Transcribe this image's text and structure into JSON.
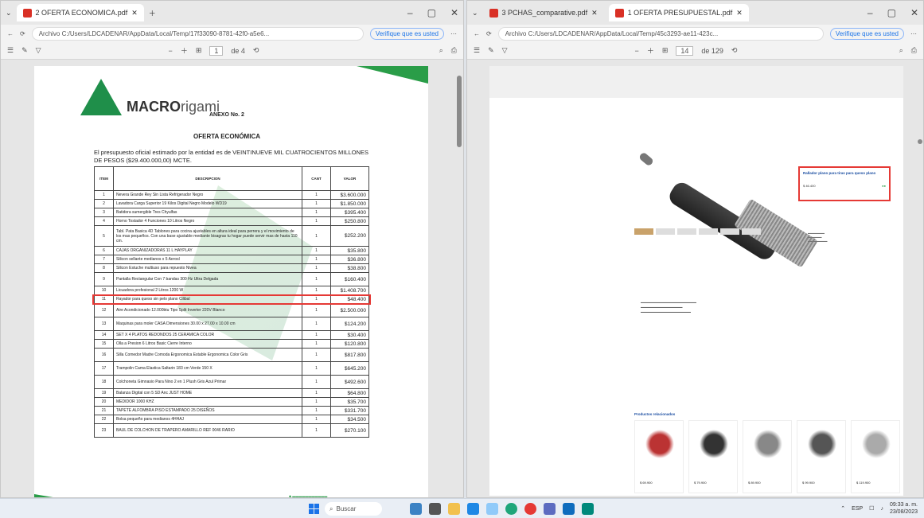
{
  "left": {
    "tab_title": "2 OFERTA ECONOMICA.pdf",
    "url": "Archivo C:/Users/LDCADENAR/AppData/Local/Temp/17f33090-8781-42f0-a5e6...",
    "verify_pill": "Verifique que es usted",
    "page_num": "1",
    "page_total": "de 4",
    "doc": {
      "brand_bold": "MACRO",
      "brand_light": "rigami",
      "anexo": "ANEXO No. 2",
      "oferta": "OFERTA ECONÓMICA",
      "intro": "El presupuesto oficial estimado por la entidad es de VEINTINUEVE MIL CUATROCIENTOS MILLONES DE PESOS ($29.400.000,00) MCTE.",
      "col_item": "ITEM",
      "col_desc": "DESCRIPCION",
      "col_qty": "CANT",
      "col_val": "VALOR",
      "rows": [
        {
          "item": "1",
          "desc": "Nevera Grande Rey Sin Lista Refrigerador Negro",
          "qty": "1",
          "val": "$3.600.000"
        },
        {
          "item": "2",
          "desc": "Lavadora Carga Superior 19 Kilos Digital Negro Modelo WD19",
          "qty": "1",
          "val": "$1.850.000"
        },
        {
          "item": "3",
          "desc": "Batidora sumergible Tres Chyulfas",
          "qty": "1",
          "val": "$395.400"
        },
        {
          "item": "4",
          "desc": "Horno Tostador 4 Funciones 10 Litros Negro",
          "qty": "1",
          "val": "$250.800"
        },
        {
          "item": "5",
          "desc": "Tabl. Pata Basica 4D Tablones para cocina ajustables en altura ideal para perrera y el movimiento de los mas pequeños. Con una base ajustable mediante bisagras tu hogar puede servir mas de hasta 110 cm.",
          "qty": "1",
          "val": "$252.200"
        },
        {
          "item": "6",
          "desc": "CAJAS ORGANIZADORAS 11 L HAYPLAY",
          "qty": "1",
          "val": "$35.800"
        },
        {
          "item": "7",
          "desc": "Silicon sellante medianos x 5 Aerosl",
          "qty": "1",
          "val": "$36.800"
        },
        {
          "item": "8",
          "desc": "Silicon Estuche multiuso para repuesto Nivea",
          "qty": "1",
          "val": "$38.800"
        },
        {
          "item": "9",
          "desc": "Pantalla Rectangular Con 7 bandas 300 Hz Ultra Delgada",
          "qty": "1",
          "val": "$160.400"
        },
        {
          "item": "10",
          "desc": "Licuadora profesional 2 Litros 1200 W",
          "qty": "1",
          "val": "$1.408.700"
        },
        {
          "item": "11",
          "desc": "Rayador para queso sin pelo plano Cilibal",
          "qty": "1",
          "val": "$48.400"
        },
        {
          "item": "12",
          "desc": "Aire Acondicionado 12.000btu Tipo Split Inverter 220V Blanco",
          "qty": "1",
          "val": "$2.500.000"
        },
        {
          "item": "13",
          "desc": "Maquinas para moler CASA Dimensiones 30.00 x 27.00 x 10.00 cm",
          "qty": "1",
          "val": "$124.200"
        },
        {
          "item": "14",
          "desc": "SET X 4 PLATOS REDONDOS 25 CERAMICA COLOR",
          "qty": "1",
          "val": "$30.400"
        },
        {
          "item": "15",
          "desc": "Olla a Presion 6 Litros Basic Cierre Interno",
          "qty": "1",
          "val": "$120.800"
        },
        {
          "item": "16",
          "desc": "Silla Comedor Madre Comoda Ergonomica Estable Ergonomica Color Gris",
          "qty": "1",
          "val": "$817.800"
        },
        {
          "item": "17",
          "desc": "Trampolin Cama Elastica Saltarin 183 cm Verde 150 X",
          "qty": "1",
          "val": "$645.200"
        },
        {
          "item": "18",
          "desc": "Colchoneta Gimnasio Para Nino 2 en 1 Plush Gris Azul Primar",
          "qty": "1",
          "val": "$492.600"
        },
        {
          "item": "19",
          "desc": "Balanza Digital con 5 SD Anc JUST HOME",
          "qty": "1",
          "val": "$64.800"
        },
        {
          "item": "20",
          "desc": "MEDIDOR 1000 KHZ",
          "qty": "1",
          "val": "$35.700"
        },
        {
          "item": "21",
          "desc": "TAPETE ALFOMBRA PISO ESTAMPADO 25 DISEÑOS",
          "qty": "1",
          "val": "$331.700"
        },
        {
          "item": "22",
          "desc": "Bolsa pequeño para medianos 4HHAJ",
          "qty": "1",
          "val": "$34.500"
        },
        {
          "item": "23",
          "desc": "BAUL DE COLCHON DE TRAPERO AMARILLO REF 0046 RARIO",
          "qty": "1",
          "val": "$270.100"
        }
      ]
    }
  },
  "right": {
    "tab1_title": "3 PCHAS_comparative.pdf",
    "tab2_title": "1 OFERTA PRESUPUESTAL.pdf",
    "url": "Archivo C:/Users/LDCADENAR/AppData/Local/Temp/45c3293-ae11-423c...",
    "verify_pill": "Verifique que es usted",
    "page_num": "14",
    "page_total": "de 129",
    "product_title": "Rallador plano para tiras para queso plano",
    "product_price": "$ 46.400",
    "related_title": "Productos relacionados",
    "cards": [
      {
        "price": "$ 69.900"
      },
      {
        "price": "$ 79.900"
      },
      {
        "price": "$ 89.900"
      },
      {
        "price": "$ 99.900"
      },
      {
        "price": "$ 119.900"
      }
    ]
  },
  "taskbar": {
    "search_placeholder": "Buscar",
    "time": "09:33 a. m.",
    "date": "23/08/2023"
  }
}
